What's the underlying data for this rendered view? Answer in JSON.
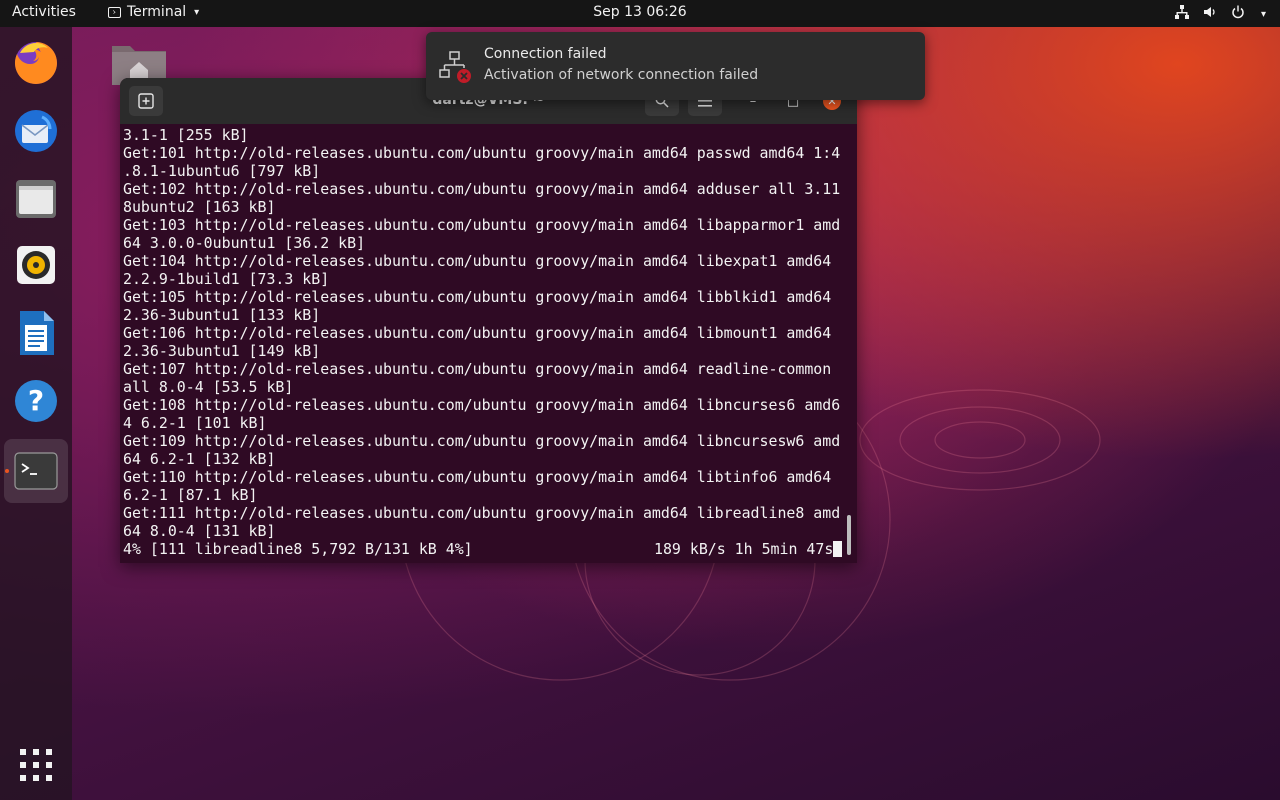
{
  "topbar": {
    "activities": "Activities",
    "app_menu": "Terminal",
    "clock": "Sep 13  06:26"
  },
  "dock": {
    "items": [
      {
        "name": "firefox-icon",
        "active": false
      },
      {
        "name": "thunderbird-icon",
        "active": false
      },
      {
        "name": "files-icon",
        "active": false
      },
      {
        "name": "rhythmbox-icon",
        "active": false
      },
      {
        "name": "libreoffice-writer-icon",
        "active": false
      },
      {
        "name": "help-icon",
        "active": false
      },
      {
        "name": "terminal-icon",
        "active": true
      },
      {
        "name": "show-applications-icon",
        "active": false
      }
    ]
  },
  "notification": {
    "title": "Connection failed",
    "body": "Activation of network connection failed"
  },
  "terminal": {
    "title": "dartz@VMS: ~",
    "lines": [
      "3.1-1 [255 kB]",
      "Get:101 http://old-releases.ubuntu.com/ubuntu groovy/main amd64 passwd amd64 1:4",
      ".8.1-1ubuntu6 [797 kB]",
      "Get:102 http://old-releases.ubuntu.com/ubuntu groovy/main amd64 adduser all 3.11",
      "8ubuntu2 [163 kB]",
      "Get:103 http://old-releases.ubuntu.com/ubuntu groovy/main amd64 libapparmor1 amd",
      "64 3.0.0-0ubuntu1 [36.2 kB]",
      "Get:104 http://old-releases.ubuntu.com/ubuntu groovy/main amd64 libexpat1 amd64",
      "2.2.9-1build1 [73.3 kB]",
      "Get:105 http://old-releases.ubuntu.com/ubuntu groovy/main amd64 libblkid1 amd64",
      "2.36-3ubuntu1 [133 kB]",
      "Get:106 http://old-releases.ubuntu.com/ubuntu groovy/main amd64 libmount1 amd64",
      "2.36-3ubuntu1 [149 kB]",
      "Get:107 http://old-releases.ubuntu.com/ubuntu groovy/main amd64 readline-common",
      "all 8.0-4 [53.5 kB]",
      "Get:108 http://old-releases.ubuntu.com/ubuntu groovy/main amd64 libncurses6 amd6",
      "4 6.2-1 [101 kB]",
      "Get:109 http://old-releases.ubuntu.com/ubuntu groovy/main amd64 libncursesw6 amd",
      "64 6.2-1 [132 kB]",
      "Get:110 http://old-releases.ubuntu.com/ubuntu groovy/main amd64 libtinfo6 amd64",
      "6.2-1 [87.1 kB]",
      "Get:111 http://old-releases.ubuntu.com/ubuntu groovy/main amd64 libreadline8 amd",
      "64 8.0-4 [131 kB]"
    ],
    "progress_left": "4% [111 libreadline8 5,792 B/131 kB 4%]",
    "progress_right": "189 kB/s 1h 5min 47s"
  },
  "colors": {
    "accent": "#e95420",
    "terminal_bg": "#2f0a24",
    "topbar_bg": "#151515"
  }
}
